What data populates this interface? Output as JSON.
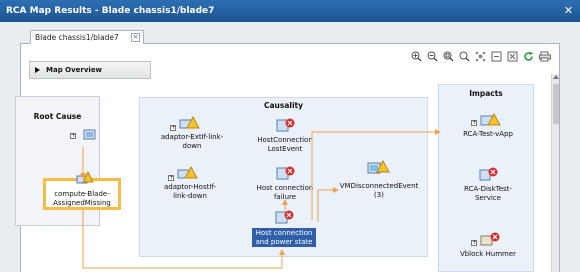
{
  "window": {
    "title": "RCA Map Results - Blade chassis1/blade7"
  },
  "tab": {
    "label": "Blade chassis1/blade7"
  },
  "map_overview": {
    "label": "Map Overview"
  },
  "groups": {
    "root_cause": {
      "title": "Root Cause"
    },
    "causality": {
      "title": "Causality"
    },
    "impacts": {
      "title": "Impacts"
    }
  },
  "nodes": {
    "compute_blade": "compute-Blade-\nAssignedMissing",
    "adaptor_ext": "adaptor-ExtIf-link-\ndown",
    "adaptor_host": "adaptor-HostIf-\nlink-down",
    "host_conn_lost": "HostConnection\nLostEvent",
    "host_conn_failure": "Host connection\nfailure",
    "host_conn_power": "Host connection\nand power state",
    "vm_disconnected": "VMDisconnectedEvent\n(3)",
    "rca_test_vapp": "RCA-Test-vApp",
    "rca_disktest": "RCA-DiskTest-\nService",
    "vblock_hummer": "Vblock Hummer"
  },
  "colors": {
    "titlebar": "#2d6fb3",
    "selection": "#2f5fa8",
    "highlight": "#f3be45",
    "connector": "#f0a050",
    "group_bg": "#eaf1f9"
  }
}
